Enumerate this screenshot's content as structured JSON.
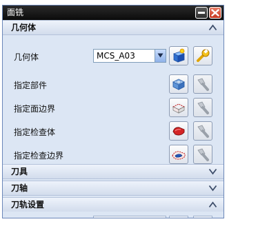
{
  "window": {
    "title": "面铣"
  },
  "sections": {
    "geometry": {
      "title": "几何体",
      "expanded": true,
      "rows": [
        {
          "label": "几何体",
          "select_value": "MCS_A03"
        },
        {
          "label": "指定部件"
        },
        {
          "label": "指定面边界"
        },
        {
          "label": "指定检查体"
        },
        {
          "label": "指定检查边界"
        }
      ]
    },
    "tool": {
      "title": "刀具",
      "expanded": false
    },
    "tool_axis": {
      "title": "刀轴",
      "expanded": false
    },
    "path_settings": {
      "title": "刀轨设置",
      "expanded": true
    }
  },
  "icons": {
    "close": "close-icon",
    "minimize": "minimize-icon",
    "new_geometry": "new-geometry-icon",
    "edit": "wrench-icon",
    "display": "flashlight-icon",
    "select_part": "part-body-icon",
    "select_face_boundary": "face-boundary-icon",
    "select_check_body": "check-body-icon",
    "select_check_boundary": "check-boundary-icon"
  },
  "colors": {
    "title_bar": "#111111",
    "panel_bg": "#dce6f4",
    "close_red": "#c4341c",
    "accent_blue": "#3a78d6"
  }
}
